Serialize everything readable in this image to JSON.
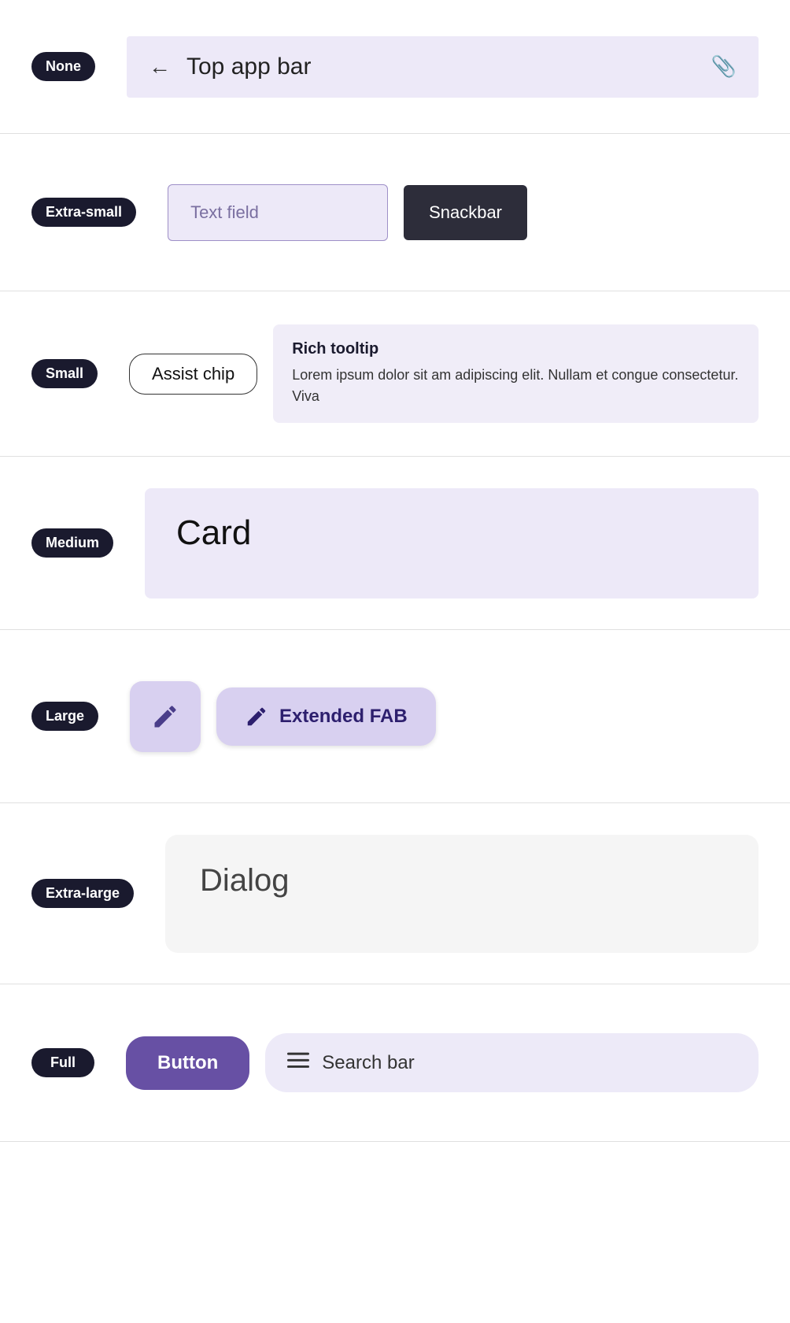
{
  "rows": [
    {
      "id": "row-none",
      "label": "None",
      "content_type": "top-app-bar",
      "top_app_bar": {
        "title": "Top app bar",
        "back_icon": "←",
        "attach_icon": "📎"
      }
    },
    {
      "id": "row-extra-small",
      "label": "Extra-small",
      "content_type": "text-field-snackbar",
      "text_field": {
        "placeholder": "Text field"
      },
      "snackbar": {
        "label": "Snackbar"
      }
    },
    {
      "id": "row-small",
      "label": "Small",
      "content_type": "assist-chip-tooltip",
      "assist_chip": {
        "label": "Assist chip"
      },
      "rich_tooltip": {
        "title": "Rich tooltip",
        "text": "Lorem ipsum dolor sit am adipiscing elit. Nullam et congue consectetur. Viva"
      }
    },
    {
      "id": "row-medium",
      "label": "Medium",
      "content_type": "card",
      "card": {
        "title": "Card"
      }
    },
    {
      "id": "row-large",
      "label": "Large",
      "content_type": "fab",
      "extended_fab": {
        "label": "Extended FAB"
      }
    },
    {
      "id": "row-extra-large",
      "label": "Extra-large",
      "content_type": "dialog",
      "dialog": {
        "title": "Dialog"
      }
    },
    {
      "id": "row-full",
      "label": "Full",
      "content_type": "button-searchbar",
      "button": {
        "label": "Button"
      },
      "search_bar": {
        "placeholder": "Search bar"
      }
    }
  ]
}
